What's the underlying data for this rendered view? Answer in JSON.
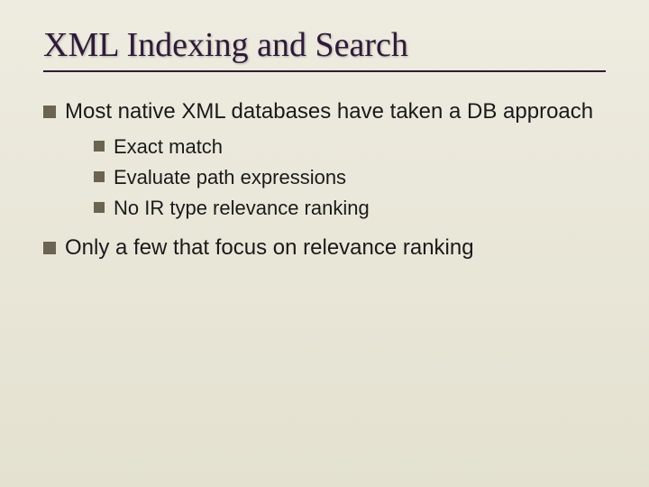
{
  "title": "XML Indexing and Search",
  "bullets": {
    "item1": "Most native XML databases have taken a DB approach",
    "sub": {
      "s1": "Exact match",
      "s2": "Evaluate path expressions",
      "s3": "No IR type relevance ranking"
    },
    "item2": "Only a few that focus on relevance ranking"
  }
}
